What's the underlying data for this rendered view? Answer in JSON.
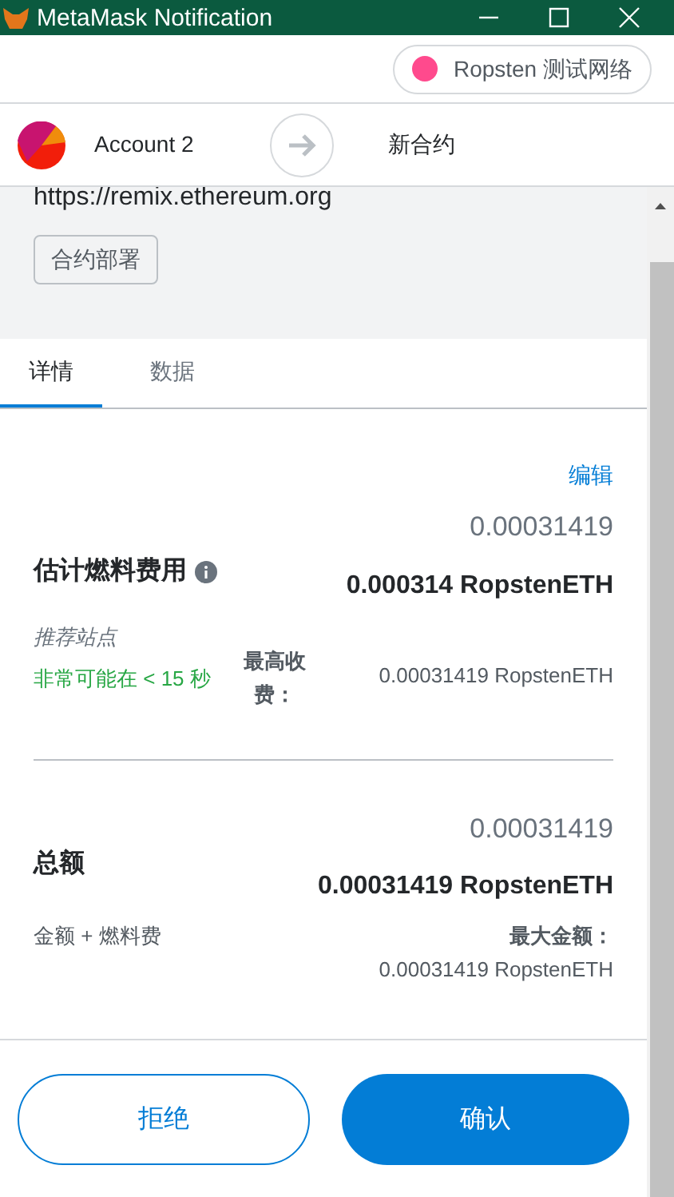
{
  "window": {
    "title": "MetaMask Notification"
  },
  "network": {
    "label": "Ropsten 测试网络",
    "color": "#ff4a8d"
  },
  "accounts": {
    "from": "Account 2",
    "to": "新合约"
  },
  "origin": {
    "url": "https://remix.ethereum.org",
    "badge": "合约部署"
  },
  "tabs": [
    {
      "label": "详情",
      "selected": true
    },
    {
      "label": "数据",
      "selected": false
    }
  ],
  "gas": {
    "edit": "编辑",
    "title": "估计燃料费用",
    "fiat": "0.00031419",
    "amount": "0.000314 RopstenETH",
    "speed": "推荐站点",
    "likely": "非常可能在 < 15 秒",
    "max_label": "最高收费：",
    "max_value": "0.00031419 RopstenETH"
  },
  "total": {
    "title": "总额",
    "fiat": "0.00031419",
    "amount": "0.00031419 RopstenETH",
    "note": "金额 + 燃料费",
    "max_label": "最大金额：",
    "max_value": "0.00031419 RopstenETH"
  },
  "buttons": {
    "reject": "拒绝",
    "confirm": "确认"
  }
}
